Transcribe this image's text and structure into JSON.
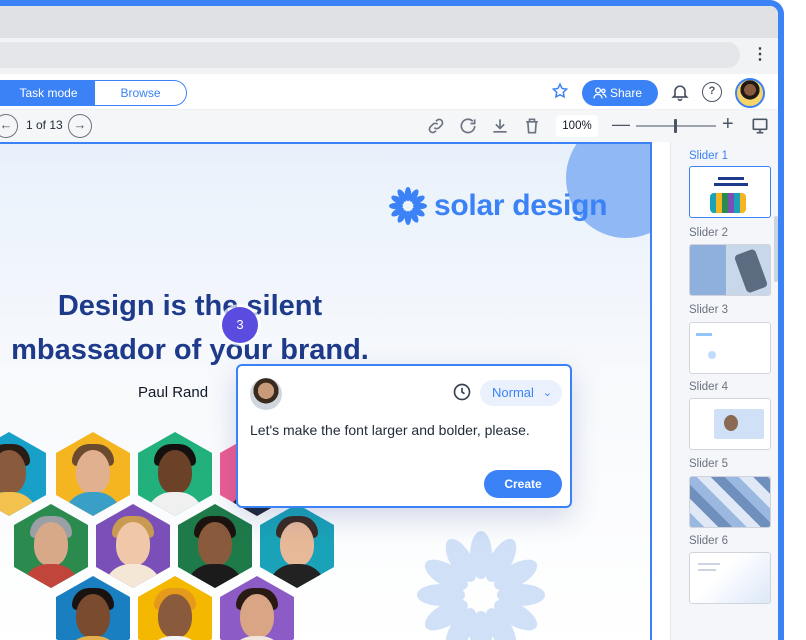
{
  "toolbar": {
    "task_mode": "Task mode",
    "browse": "Browse",
    "share": "Share",
    "help_glyph": "?",
    "menu_glyph": "⋮"
  },
  "pager": {
    "current": "1 of 13",
    "prev_glyph": "←",
    "next_glyph": "→",
    "zoom": "100%"
  },
  "slide": {
    "brand": "solar design",
    "headline_line1": "Design is the silent",
    "headline_line2": "mbassador of your brand.",
    "author": "Paul Rand",
    "step_badge": "3"
  },
  "comment": {
    "priority": "Normal",
    "text": "Let's make the font larger and bolder, please.",
    "create": "Create"
  },
  "thumbnails": [
    {
      "label": "Slider 1"
    },
    {
      "label": "Slider 2"
    },
    {
      "label": "Slider 3"
    },
    {
      "label": "Slider 4"
    },
    {
      "label": "Slider 5"
    },
    {
      "label": "Slider 6"
    }
  ],
  "colors": {
    "accent": "#3b82f6",
    "headline": "#1e3a8a",
    "badge": "#5b4ce0"
  }
}
